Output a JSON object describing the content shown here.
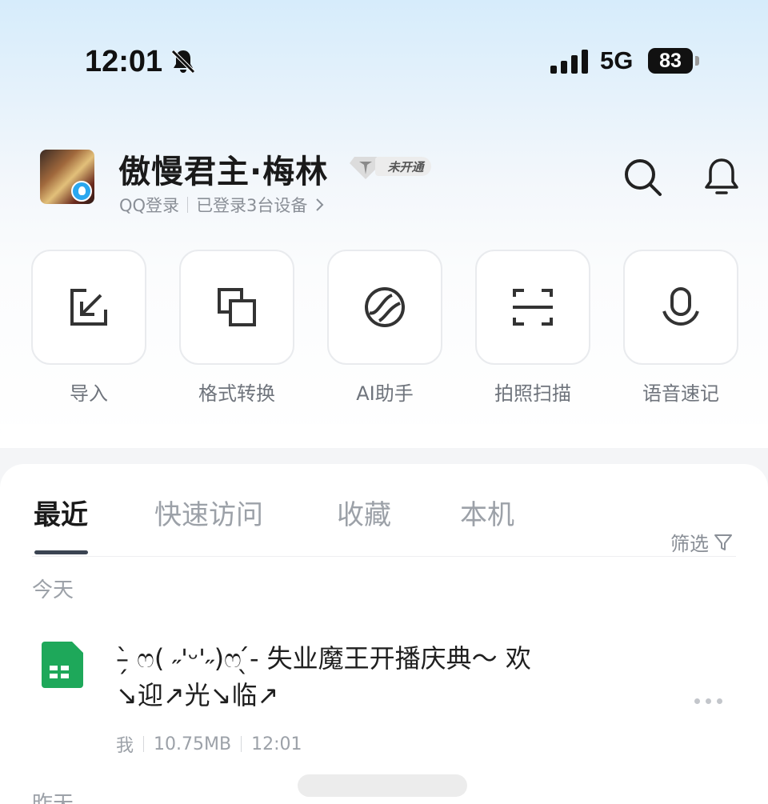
{
  "status_bar": {
    "time": "12:01",
    "network": "5G",
    "battery": "83"
  },
  "profile": {
    "name": "傲慢君主·梅林",
    "vip_label": "未开通",
    "login_source": "QQ登录",
    "devices": "已登录3台设备"
  },
  "quick_actions": [
    {
      "label": "导入",
      "icon": "import-icon"
    },
    {
      "label": "格式转换",
      "icon": "format-convert-icon"
    },
    {
      "label": "AI助手",
      "icon": "ai-assistant-icon"
    },
    {
      "label": "拍照扫描",
      "icon": "scan-icon"
    },
    {
      "label": "语音速记",
      "icon": "voice-memo-icon"
    }
  ],
  "tabs": [
    {
      "label": "最近",
      "active": true
    },
    {
      "label": "快速访问",
      "active": false
    },
    {
      "label": "收藏",
      "active": false
    },
    {
      "label": "本机",
      "active": false
    }
  ],
  "filter_label": "筛选",
  "sections": {
    "today": "今天",
    "yesterday": "昨天"
  },
  "files": [
    {
      "name_line1": "–̗̀ ෆ( ˶'ᵕ'˶)ෆ ̖́- 失业魔王开播庆典～ 欢",
      "name_line2": "↘迎↗光↘临↗",
      "owner": "我",
      "size": "10.75MB",
      "time": "12:01",
      "icon": "spreadsheet-icon"
    }
  ],
  "colors": {
    "spreadsheet_green": "#1ea85a",
    "tab_indicator": "#3b4452"
  }
}
